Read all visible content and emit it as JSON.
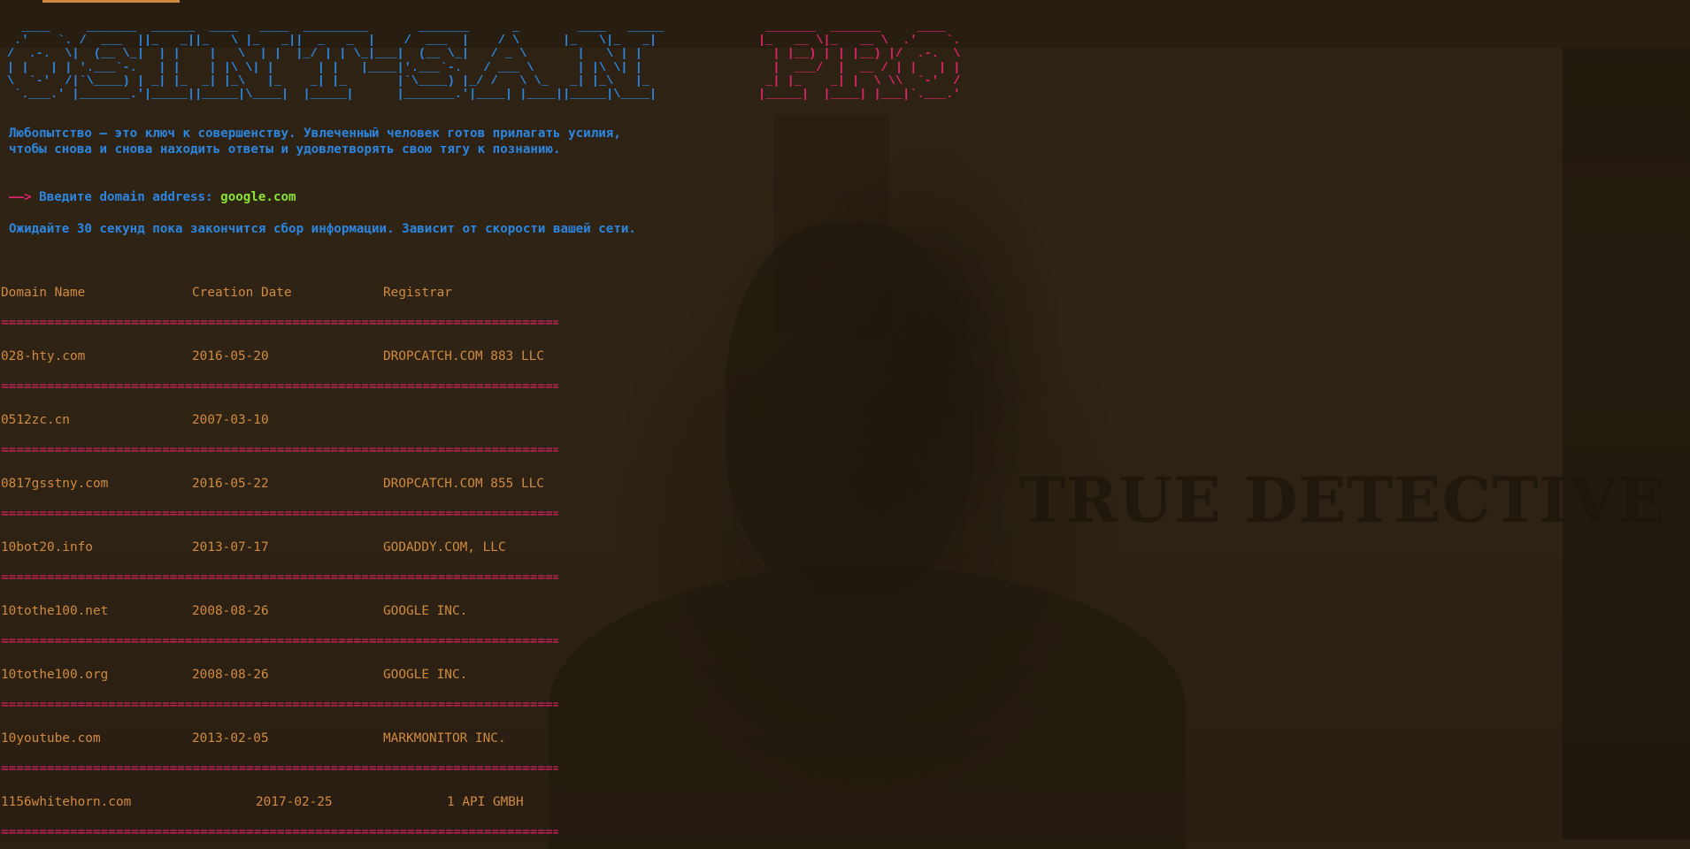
{
  "banner": {
    "osint_lines": [
      "  ____     _______  ______  ____   ____  _________       _______      _        ____   _____",
      " .'    `. /  ___  ||_   _||_   \\ |_   _||  _   _  |    /  ___  |    / \\      |_   \\|_   _|",
      "/  .-.  \\|  (__ \\_|  | |    |   \\  | |  |_/ | | \\_|___|  (__ \\_|   / _ \\       |   \\ | |",
      "| |   | | '.___`-.   | |    | |\\ \\| |      | |   |____|'.___`-.   / ___ \\      | |\\ \\| |",
      "\\  `-'  /|`\\____) | _| |_  _| |_\\   |_    _| |_       |`\\____) |_/ /   \\ \\_   _| |_\\   |_",
      " `.___.' |_______.'|_____||_____|\\____|  |_____|      |_______.'|____| |____||_____|\\____|"
    ],
    "pro_lines": [
      " _______  _______     ____",
      "|_   __ \\|_   __ \\  .'    `.",
      "  | |__) | | |__) |/  .-.  \\",
      "  |  ___/  |  __ / | |   | |",
      " _| |_    _| |  \\ \\\\  `-'  /",
      "|_____|  |____| |___|`.___.'"
    ]
  },
  "quote": {
    "line1": "Любопытство — это ключ к совершенству. Увлеченный человек готов прилагать усилия,",
    "line2": "чтобы снова и снова находить ответы и удовлетворять свою тягу к познанию."
  },
  "prompt": {
    "arrow": "——>",
    "label": " Введите domain address: ",
    "value": "google.com"
  },
  "wait_message": "Ожидайте 30 секунд пока закончится сбор информации. Зависит от скорости вашей сети.",
  "table": {
    "headers": [
      "Domain Name",
      "Creation Date",
      "Registrar"
    ],
    "separator": "==================================================================================================",
    "rows": [
      {
        "domain": "028-hty.com",
        "date": "2016-05-20",
        "registrar": "DROPCATCH.COM 883 LLC"
      },
      {
        "domain": "0512zc.cn",
        "date": "2007-03-10",
        "registrar": ""
      },
      {
        "domain": "0817gsstny.com",
        "date": "2016-05-22",
        "registrar": "DROPCATCH.COM 855 LLC"
      },
      {
        "domain": "10bot20.info",
        "date": "2013-07-17",
        "registrar": "GODADDY.COM, LLC"
      },
      {
        "domain": "10tothe100.net",
        "date": "2008-08-26",
        "registrar": "GOOGLE INC."
      },
      {
        "domain": "10tothe100.org",
        "date": "2008-08-26",
        "registrar": "GOOGLE INC."
      },
      {
        "domain": "10youtube.com",
        "date": "2013-02-05",
        "registrar": "MARKMONITOR INC."
      },
      {
        "domain": "1156whitehorn.com",
        "date": "2017-02-25",
        "registrar": "1 API GMBH"
      }
    ]
  },
  "wallpaper": {
    "title": "TRUE DETECTIVE"
  },
  "colors": {
    "blue": "#2c86e0",
    "pink": "#e0246a",
    "orange": "#d08a40",
    "green": "#8be234",
    "background": "#2b2013"
  }
}
